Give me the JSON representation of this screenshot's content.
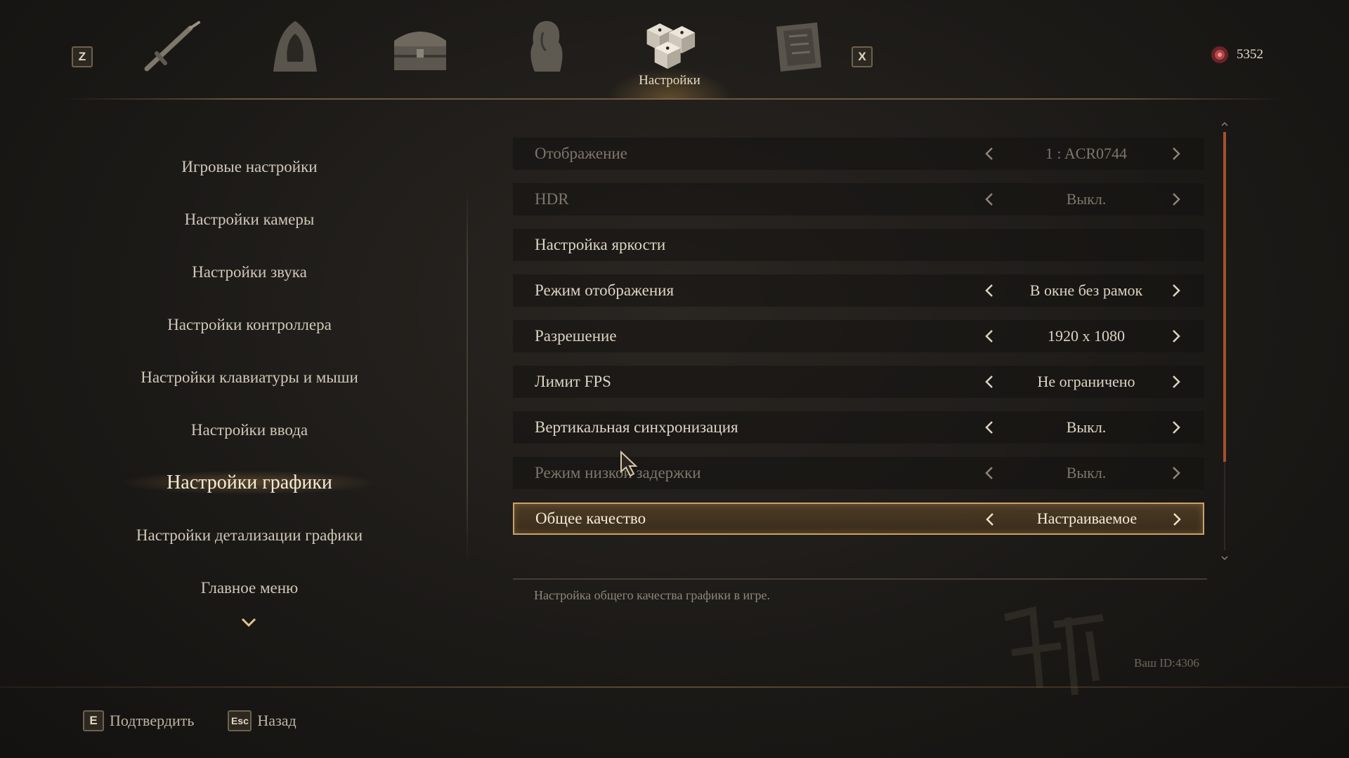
{
  "top_nav": {
    "prev_key": "Z",
    "next_key": "X",
    "tabs": [
      {
        "icon": "sword-icon",
        "label": ""
      },
      {
        "icon": "hood-icon",
        "label": ""
      },
      {
        "icon": "chest-icon",
        "label": ""
      },
      {
        "icon": "character-icon",
        "label": ""
      },
      {
        "icon": "dice-icon",
        "label": "Настройки",
        "active": true
      },
      {
        "icon": "scroll-icon",
        "label": ""
      }
    ],
    "currency": {
      "icon": "currency-gem-icon",
      "amount": "5352"
    }
  },
  "left_menu": {
    "items": [
      "Игровые настройки",
      "Настройки камеры",
      "Настройки звука",
      "Настройки контроллера",
      "Настройки клавиатуры и мыши",
      "Настройки ввода",
      "Настройки графики",
      "Настройки детализации графики",
      "Главное меню"
    ],
    "active_index": 6
  },
  "settings": {
    "rows": [
      {
        "label": "Отображение",
        "value": "1 : ACR0744",
        "state": "disabled"
      },
      {
        "label": "HDR",
        "value": "Выкл.",
        "state": "disabled"
      },
      {
        "label": "Настройка яркости",
        "value": "",
        "state": "normal"
      },
      {
        "label": "Режим отображения",
        "value": "В окне без рамок",
        "state": "normal"
      },
      {
        "label": "Разрешение",
        "value": "1920 x 1080",
        "state": "normal"
      },
      {
        "label": "Лимит FPS",
        "value": "Не ограничено",
        "state": "normal"
      },
      {
        "label": "Вертикальная синхронизация",
        "value": "Выкл.",
        "state": "normal"
      },
      {
        "label": "Режим низкой задержки",
        "value": "Выкл.",
        "state": "disabled"
      },
      {
        "label": "Общее качество",
        "value": "Настраиваемое",
        "state": "selected"
      }
    ]
  },
  "description": "Настройка общего качества графики в игре.",
  "user_id": "Ваш ID:4306",
  "bottom_hints": {
    "confirm": {
      "key": "E",
      "label": "Подтвердить"
    },
    "back": {
      "key": "Esc",
      "label": "Назад"
    }
  },
  "colors": {
    "accent": "#c9a26a",
    "scroll_thumb": "#a2512d",
    "background": "#1c1a17"
  }
}
